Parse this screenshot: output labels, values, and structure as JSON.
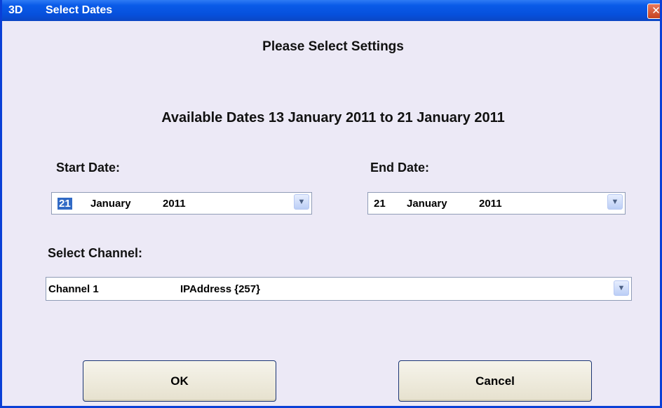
{
  "window": {
    "icon_text": "3D",
    "title": "Select Dates",
    "close_symbol": "✕"
  },
  "heading": "Please Select Settings",
  "available_dates": "Available Dates 13 January 2011 to 21 January 2011",
  "start_date": {
    "label": "Start Date:",
    "day": "21",
    "month": "January",
    "year": "2011"
  },
  "end_date": {
    "label": "End Date:",
    "day": "21",
    "month": "January",
    "year": "2011"
  },
  "channel": {
    "label": "Select Channel:",
    "name": "Channel 1",
    "address": "IPAddress {257}"
  },
  "buttons": {
    "ok": "OK",
    "cancel": "Cancel"
  },
  "icons": {
    "dropdown": "chevron-down-icon",
    "close": "close-icon"
  },
  "colors": {
    "titlebar": "#0A5BE8",
    "dialog_bg": "#ECE9F6",
    "selection": "#316AC5",
    "close_button": "#D6532F"
  }
}
